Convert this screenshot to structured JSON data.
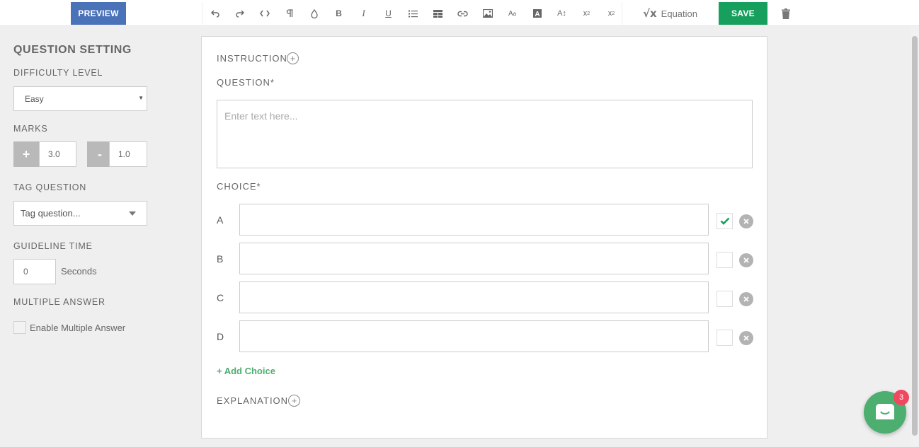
{
  "toolbar": {
    "preview_label": "PREVIEW",
    "save_label": "SAVE",
    "equation_label": "Equation",
    "equation_symbol": "√x",
    "tools": [
      {
        "name": "undo-icon",
        "glyph": "↶"
      },
      {
        "name": "redo-icon",
        "glyph": "↷"
      },
      {
        "name": "code-icon",
        "glyph": "<>"
      },
      {
        "name": "paragraph-icon",
        "glyph": "¶"
      },
      {
        "name": "color-drop-icon",
        "glyph": "◊"
      },
      {
        "name": "bold-icon",
        "glyph": "B"
      },
      {
        "name": "italic-icon",
        "glyph": "I"
      },
      {
        "name": "underline-icon",
        "glyph": "U"
      },
      {
        "name": "list-icon",
        "glyph": "≡"
      },
      {
        "name": "table-icon",
        "glyph": "▦"
      },
      {
        "name": "link-icon",
        "glyph": "∞"
      },
      {
        "name": "image-icon",
        "glyph": "▣"
      },
      {
        "name": "font-size-icon",
        "glyph": "Aa"
      },
      {
        "name": "highlight-icon",
        "glyph": "A"
      },
      {
        "name": "line-height-icon",
        "glyph": "A↕"
      },
      {
        "name": "superscript-icon",
        "glyph": "x²"
      },
      {
        "name": "subscript-icon",
        "glyph": "x₂"
      }
    ]
  },
  "sidebar": {
    "title": "QUESTION SETTING",
    "difficulty_label": "DIFFICULTY LEVEL",
    "difficulty_value": "Easy",
    "marks_label": "MARKS",
    "marks_plus_symbol": "+",
    "marks_plus_value": "3.0",
    "marks_minus_symbol": "-",
    "marks_minus_value": "1.0",
    "tag_label": "TAG QUESTION",
    "tag_placeholder": "Tag question...",
    "guideline_label": "GUIDELINE TIME",
    "guideline_value": "0",
    "guideline_unit": "Seconds",
    "multiple_label": "MULTIPLE ANSWER",
    "multiple_checkbox_label": "Enable Multiple Answer"
  },
  "main": {
    "instruction_label": "INSTRUCTION",
    "question_label": "QUESTION*",
    "question_placeholder": "Enter text here...",
    "choice_label": "CHOICE*",
    "choices": [
      {
        "letter": "A",
        "correct": true
      },
      {
        "letter": "B",
        "correct": false
      },
      {
        "letter": "C",
        "correct": false
      },
      {
        "letter": "D",
        "correct": false
      }
    ],
    "add_choice_label": "+ Add Choice",
    "explanation_label": "EXPLANATION"
  },
  "chat": {
    "badge_count": "3"
  },
  "colors": {
    "preview_blue": "#4a72b8",
    "save_green": "#17a05d",
    "check_green": "#17a05d",
    "chat_green": "#4caf70",
    "badge_red": "#f0485f"
  }
}
